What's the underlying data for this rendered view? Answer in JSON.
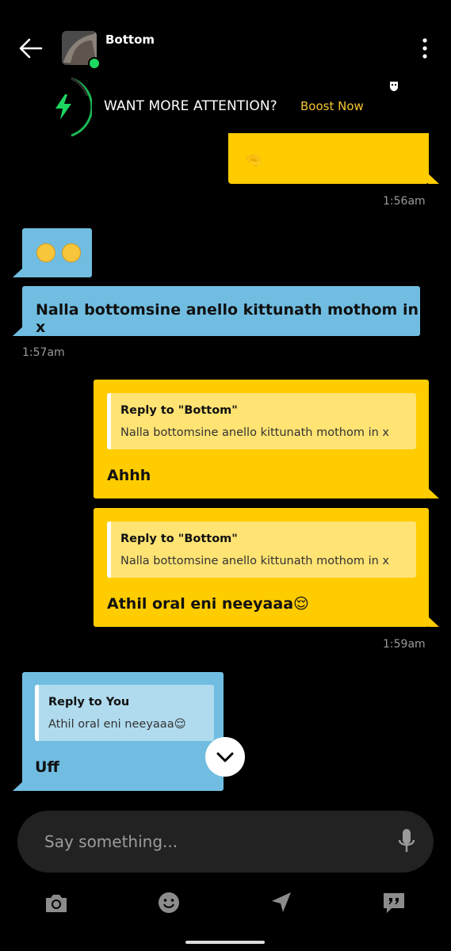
{
  "header": {
    "contact_name": "Bottom",
    "back_icon": "arrow-left-icon",
    "more_icon": "more-vertical-icon",
    "online": true
  },
  "boost": {
    "text": "WANT MORE ATTENTION?",
    "link": "Boost Now",
    "accent": "#f6c532",
    "bolt_color": "#1ed760"
  },
  "messages": [
    {
      "from": "me",
      "content": "🤏",
      "time": "1:56am"
    },
    {
      "from": "them",
      "content": "😅😅"
    },
    {
      "from": "them",
      "content": "Nalla bottomsine anello kittunath mothom in x",
      "time": "1:57am"
    },
    {
      "from": "me",
      "reply_title": "Reply to \"Bottom\"",
      "reply_body": "Nalla bottomsine anello kittunath mothom in x",
      "content": "Ahhh"
    },
    {
      "from": "me",
      "reply_title": "Reply to \"Bottom\"",
      "reply_body": "Nalla bottomsine anello kittunath mothom in x",
      "content": "Athil oral eni neeyaaa😌",
      "time": "1:59am"
    },
    {
      "from": "them",
      "reply_title": "Reply to You",
      "reply_body": "Athil oral eni neeyaaa😌",
      "content": "Uff"
    }
  ],
  "composer": {
    "placeholder": "Say something..."
  },
  "toolbar": {
    "icons": [
      "camera-icon",
      "emoji-icon",
      "location-icon",
      "saved-phrases-icon"
    ]
  },
  "colors": {
    "my_bubble": "#ffcc00",
    "their_bubble": "#70bde1",
    "background": "#000000"
  }
}
